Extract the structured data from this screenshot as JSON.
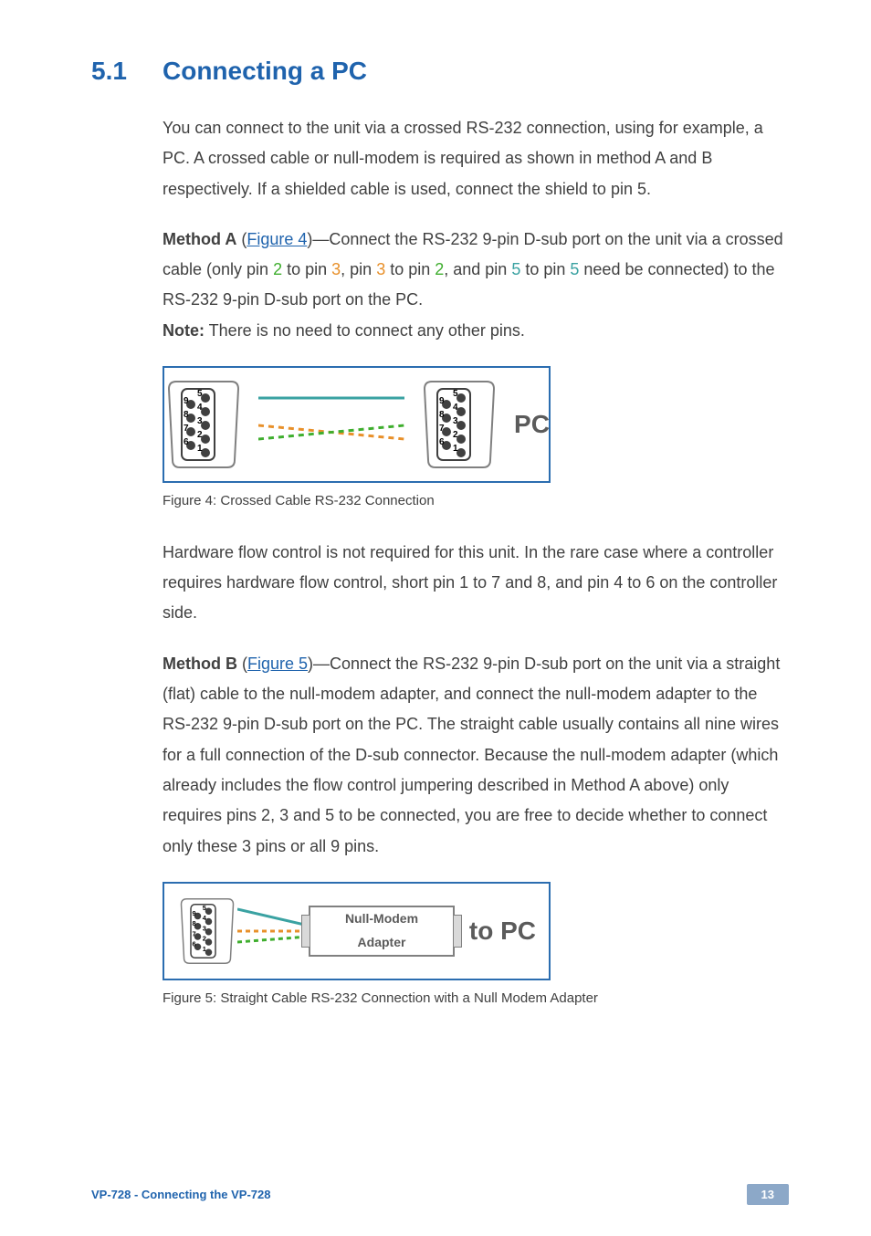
{
  "heading": {
    "number": "5.1",
    "title": "Connecting a PC"
  },
  "intro": "You can connect to the unit via a crossed RS-232 connection, using for example, a PC. A crossed cable or null-modem is required as shown in method A and B respectively. If a shielded cable is used, connect the shield to pin 5.",
  "method_a": {
    "label": "Method A",
    "link_text": "Figure 4",
    "after_link": ")—Connect the RS-232 9-pin D-sub port on the unit via a crossed cable (only pin ",
    "p2a": "2",
    "p2b": " to pin ",
    "p3a": "3",
    "p3b": ", pin ",
    "p3c": "3",
    "p3d": " to pin ",
    "p2c": "2",
    "p3e": ", and pin ",
    "p5a": "5",
    "p5b": " to pin ",
    "p5c": "5",
    "tail": " need be connected) to the RS-232 9-pin D-sub port on the PC.",
    "note_label": "Note:",
    "note_text": " There is no need to connect any other pins."
  },
  "figure4": {
    "caption": "Figure 4: Crossed Cable RS-232 Connection",
    "pc": "PC"
  },
  "middle_para": "Hardware flow control is not required for this unit. In the rare case where a controller requires hardware flow control, short pin 1 to 7 and 8, and pin 4 to 6 on the controller side.",
  "method_b": {
    "label": "Method B",
    "link_text": "Figure 5",
    "after_link": ")—Connect the RS-232 9-pin D-sub port on the unit via a straight (flat) cable to the null-modem adapter, and connect the null-modem adapter to the RS-232 9-pin D-sub port on the PC. The straight cable usually contains all nine wires for a full connection of the D-sub connector. Because the null-modem adapter (which already includes the flow control jumpering described in Method A above) only requires pins 2, 3 and 5 to be connected, you are free to decide whether to connect only these 3 pins or all 9 pins."
  },
  "figure5": {
    "caption": "Figure 5: Straight Cable RS-232 Connection with a Null Modem Adapter",
    "null_modem": "Null-Modem\nAdapter",
    "to_pc": "to PC"
  },
  "pins": {
    "p1": "1",
    "p2": "2",
    "p3": "3",
    "p4": "4",
    "p5": "5",
    "p6": "6",
    "p7": "7",
    "p8": "8",
    "p9": "9"
  },
  "footer": {
    "left": "VP-728 - Connecting the VP-728",
    "right": "13"
  }
}
